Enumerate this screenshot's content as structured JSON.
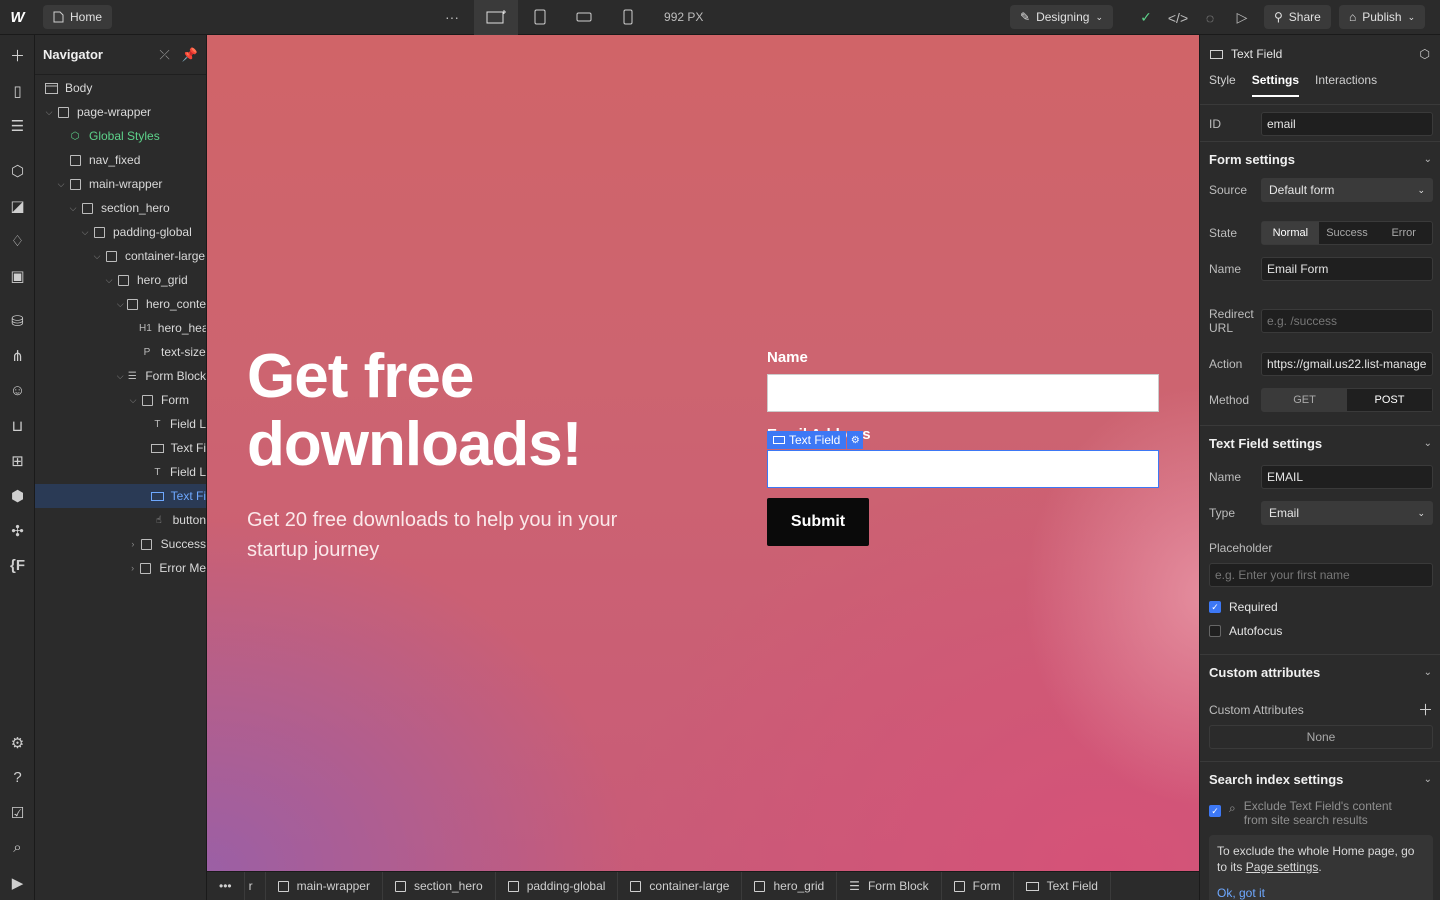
{
  "topbar": {
    "logo": "W",
    "home_label": "Home",
    "more_icon": "ellipsis-icon",
    "breakpoints": [
      "desktop-star-icon",
      "tablet-icon",
      "mobile-landscape-icon",
      "mobile-portrait-icon"
    ],
    "width_readout": "992 PX",
    "mode_label": "Designing",
    "share_label": "Share",
    "publish_label": "Publish"
  },
  "rail": {
    "icons": [
      "add-icon",
      "pages-icon",
      "navigator-icon",
      "components-icon",
      "style-selector-icon",
      "variables-icon",
      "assets-icon",
      "cms-icon",
      "logic-icon",
      "users-icon",
      "ecommerce-icon",
      "apps-icon",
      "ai-icon",
      "integrations-icon",
      "fonts-icon"
    ],
    "bottom_icons": [
      "settings-icon",
      "help-icon",
      "audit-icon",
      "search-icon",
      "video-icon"
    ]
  },
  "navigator": {
    "title": "Navigator",
    "items": [
      {
        "label": "Body"
      },
      {
        "label": "page-wrapper"
      },
      {
        "label": "Global Styles"
      },
      {
        "label": "nav_fixed"
      },
      {
        "label": "main-wrapper"
      },
      {
        "label": "section_hero"
      },
      {
        "label": "padding-global"
      },
      {
        "label": "container-large"
      },
      {
        "label": "hero_grid"
      },
      {
        "label": "hero_conte"
      },
      {
        "label": "hero_hea",
        "icon": "H1"
      },
      {
        "label": "text-size",
        "icon": "P"
      },
      {
        "label": "Form Block"
      },
      {
        "label": "Form"
      },
      {
        "label": "Field L",
        "icon": "T"
      },
      {
        "label": "Text Fi"
      },
      {
        "label": "Field L",
        "icon": "T"
      },
      {
        "label": "Text Fi"
      },
      {
        "label": "button"
      },
      {
        "label": "Success"
      },
      {
        "label": "Error Me"
      }
    ]
  },
  "canvas": {
    "hero_title": "Get free downloads!",
    "hero_sub": "Get 20 free downloads to help you in your startup journey",
    "name_label": "Name",
    "email_label": "Email Address",
    "selection_tag": "Text Field",
    "submit_label": "Submit"
  },
  "breadcrumb": [
    "r",
    "main-wrapper",
    "section_hero",
    "padding-global",
    "container-large",
    "hero_grid",
    "Form Block",
    "Form",
    "Text Field"
  ],
  "panel": {
    "element_name": "Text Field",
    "tabs": [
      "Style",
      "Settings",
      "Interactions"
    ],
    "id_label": "ID",
    "id_value": "email",
    "form_settings": {
      "title": "Form settings",
      "source_label": "Source",
      "source_value": "Default form",
      "state_label": "State",
      "states": [
        "Normal",
        "Success",
        "Error"
      ],
      "name_label": "Name",
      "name_value": "Email Form",
      "redirect_label": "Redirect URL",
      "redirect_placeholder": "e.g. /success",
      "action_label": "Action",
      "action_value": "https://gmail.us22.list-manage",
      "method_label": "Method",
      "methods": [
        "GET",
        "POST"
      ]
    },
    "text_field_settings": {
      "title": "Text Field settings",
      "name_label": "Name",
      "name_value": "EMAIL",
      "type_label": "Type",
      "type_value": "Email",
      "placeholder_label": "Placeholder",
      "placeholder_hint": "e.g. Enter your first name",
      "required_label": "Required",
      "autofocus_label": "Autofocus"
    },
    "custom_attributes": {
      "title": "Custom attributes",
      "label": "Custom Attributes",
      "empty": "None"
    },
    "search_index": {
      "title": "Search index settings",
      "exclude_text": "Exclude Text Field's content from site search results",
      "info_text": "To exclude the whole Home page, go to its",
      "info_link": "Page settings",
      "info_ok": "Ok, got it"
    }
  }
}
